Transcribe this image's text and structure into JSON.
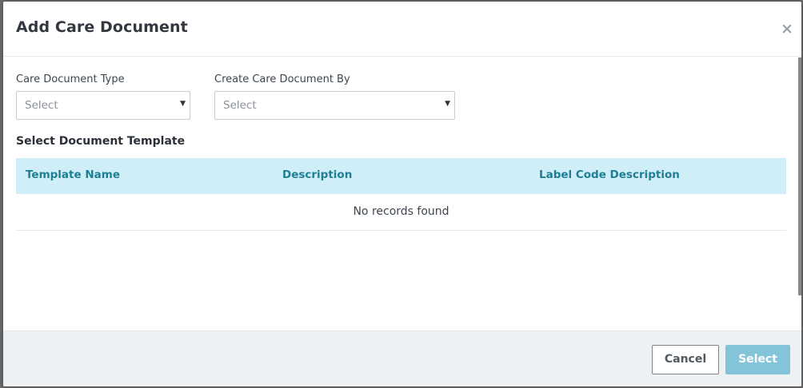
{
  "dialog": {
    "title": "Add Care Document",
    "close_glyph": "×"
  },
  "form": {
    "care_document_type": {
      "label": "Care Document Type",
      "value": "Select"
    },
    "create_by": {
      "label": "Create Care Document By",
      "value": "Select"
    },
    "dropdown_arrow": "▼"
  },
  "templates": {
    "section_title": "Select Document Template",
    "columns": [
      "Template Name",
      "Description",
      "Label Code Description"
    ],
    "empty_message": "No records found"
  },
  "footer": {
    "cancel_label": "Cancel",
    "select_label": "Select"
  },
  "colors": {
    "table_header_bg": "#d0eef8",
    "table_header_text": "#1e7f94",
    "primary_button": "#84c4d9",
    "footer_bg": "#eef1f4"
  }
}
